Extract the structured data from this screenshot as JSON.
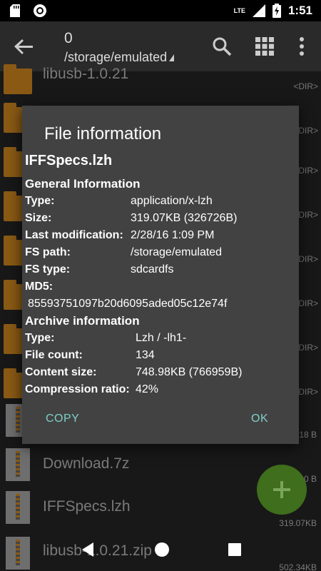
{
  "status_bar": {
    "time": "1:51",
    "network": "LTE"
  },
  "app_bar": {
    "count": "0",
    "path": "/storage/emulated"
  },
  "list": {
    "items": [
      {
        "name": "libusb-1.0.21",
        "tag": "<DIR>"
      },
      {
        "tag": "<DIR>"
      },
      {
        "tag": "<DIR>"
      },
      {
        "tag": "<DIR>"
      },
      {
        "tag": "<DIR>"
      },
      {
        "tag": "<DIR>"
      },
      {
        "tag": "<DIR>"
      },
      {
        "tag": "<DIR>"
      },
      {
        "size": "18 B"
      },
      {
        "name": "Download.7z",
        "size": "0 B"
      },
      {
        "name": "IFFSpecs.lzh",
        "size": "319.07KB"
      },
      {
        "name": "libusb-1.0.21.zip",
        "size": "502.34KB"
      }
    ]
  },
  "dialog": {
    "title": "File information",
    "filename": "IFFSpecs.lzh",
    "general_heading": "General Information",
    "general": [
      {
        "key": "Type:",
        "value": "application/x-lzh"
      },
      {
        "key": "Size:",
        "value": "319.07KB (326726B)"
      },
      {
        "key": "Last modification:",
        "value": "2/28/16 1:09 PM"
      },
      {
        "key": "FS path:",
        "value": "/storage/emulated"
      },
      {
        "key": "FS type:",
        "value": "sdcardfs"
      }
    ],
    "md5_label": "MD5:",
    "md5_value": "85593751097b20d6095aded05c12e74f",
    "archive_heading": "Archive information",
    "archive": [
      {
        "key": "Type:",
        "value": "Lzh / -lh1-"
      },
      {
        "key": "File count:",
        "value": "134"
      },
      {
        "key": "Content size:",
        "value": "748.98KB (766959B)"
      },
      {
        "key": "Compression ratio:",
        "value": "42%"
      }
    ],
    "copy_label": "COPY",
    "ok_label": "OK"
  },
  "colors": {
    "accent": "#7ed0c8",
    "fab": "#3f6e1c",
    "folder": "#8a5a15",
    "dialog_bg": "#424242"
  }
}
